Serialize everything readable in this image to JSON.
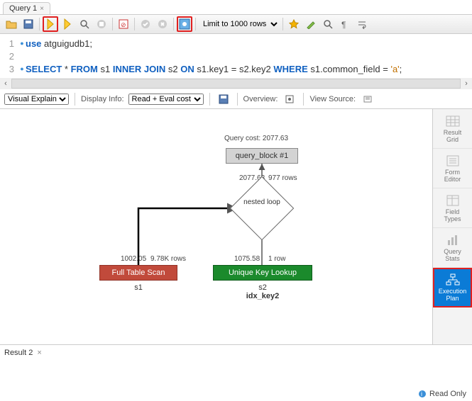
{
  "tab": {
    "title": "Query 1"
  },
  "toolbar": {
    "limit_label": "Limit to 1000 rows"
  },
  "editor": {
    "lines": [
      {
        "n": "1",
        "dot": "●",
        "tokens": [
          [
            "kw",
            "use"
          ],
          [
            "",
            " atguigudb1;"
          ]
        ]
      },
      {
        "n": "2",
        "dot": "",
        "tokens": []
      },
      {
        "n": "3",
        "dot": "●",
        "tokens": [
          [
            "kw",
            "SELECT"
          ],
          [
            "",
            " * "
          ],
          [
            "kw",
            "FROM"
          ],
          [
            "",
            " s1 "
          ],
          [
            "kw",
            "INNER JOIN"
          ],
          [
            "",
            " s2 "
          ],
          [
            "kw",
            "ON"
          ],
          [
            "",
            " s1.key1 = s2.key2 "
          ],
          [
            "kw",
            "WHERE"
          ],
          [
            "",
            " s1.common_field = "
          ],
          [
            "str",
            "'a'"
          ],
          [
            "",
            ";"
          ]
        ]
      }
    ]
  },
  "explain_bar": {
    "mode": "Visual Explain",
    "display_info_label": "Display Info:",
    "display_info_value": "Read + Eval cost",
    "overview_label": "Overview:",
    "view_source_label": "View Source:"
  },
  "plan": {
    "query_cost_label": "Query cost: 2077.63",
    "qblock": "query_block #1",
    "nested_loop": "nested loop",
    "edge_main_cost": "2077.63",
    "edge_main_rows": "977 rows",
    "fts_cost": "1002.05",
    "fts_rows": "9.78K rows",
    "ukl_cost": "1075.58",
    "ukl_rows": "1 row",
    "fts_label": "Full Table Scan",
    "ukl_label": "Unique Key Lookup",
    "s1": "s1",
    "s2": "s2",
    "idx": "idx_key2"
  },
  "side": {
    "result_grid": "Result\nGrid",
    "form_editor": "Form\nEditor",
    "field_types": "Field\nTypes",
    "query_stats": "Query\nStats",
    "execution_plan": "Execution\nPlan"
  },
  "bottom": {
    "result_tab": "Result 2",
    "read_only": "Read Only"
  }
}
